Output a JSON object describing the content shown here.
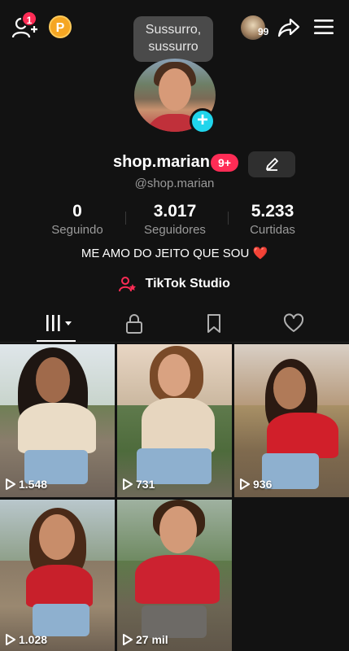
{
  "header": {
    "notification_count": "1",
    "coin_letter": "P",
    "tooltip_line1": "Sussurro,",
    "tooltip_line2": "sussurro",
    "visitor_count": "99"
  },
  "profile": {
    "username": "shop.marian",
    "badge": "9+",
    "handle": "@shop.marian",
    "stats": [
      {
        "value": "0",
        "label": "Seguindo"
      },
      {
        "value": "3.017",
        "label": "Seguidores"
      },
      {
        "value": "5.233",
        "label": "Curtidas"
      }
    ],
    "bio": "ME AMO DO JEITO QUE SOU",
    "bio_emoji": "❤️",
    "studio_label": "TikTok Studio"
  },
  "tabs": [
    "videos-grid",
    "private",
    "saved",
    "liked"
  ],
  "videos": [
    {
      "views": "1.548"
    },
    {
      "views": "731"
    },
    {
      "views": "936"
    },
    {
      "views": "1.028"
    },
    {
      "views": "27 mil"
    }
  ],
  "colors": {
    "background": "#121212",
    "accent_red": "#fe2c55",
    "accent_cyan": "#20d5ec",
    "coin": "#f5a623"
  }
}
